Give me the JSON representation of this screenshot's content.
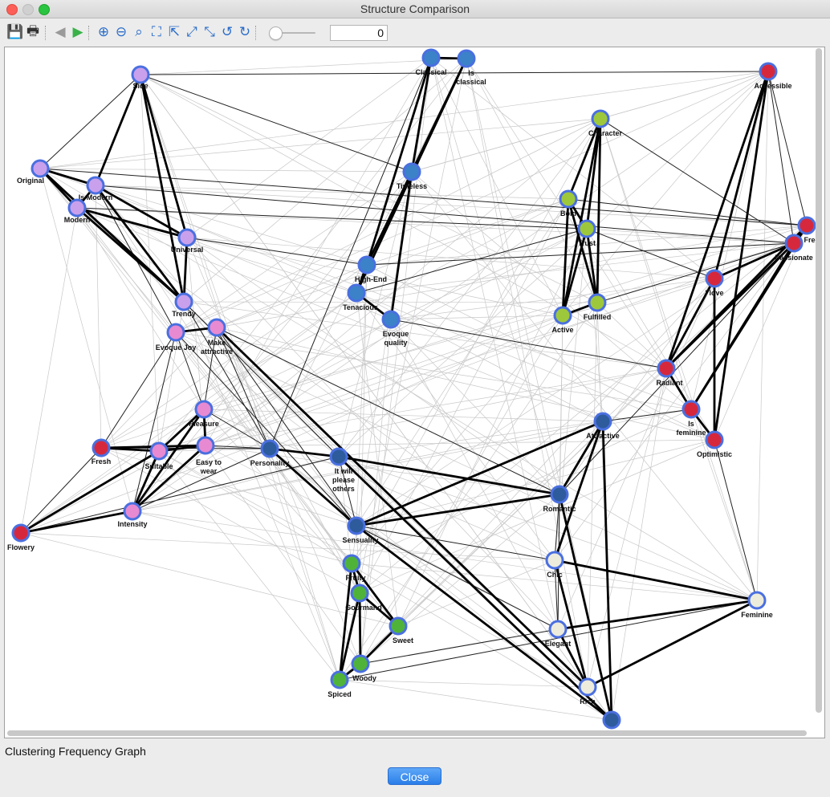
{
  "window": {
    "title": "Structure Comparison"
  },
  "toolbar": {
    "buttons": [
      {
        "name": "save-icon",
        "glyph": "💾"
      },
      {
        "name": "print-icon",
        "glyph": "🖶"
      },
      {
        "name": "back-icon",
        "glyph": "◀"
      },
      {
        "name": "forward-icon",
        "glyph": "▶"
      },
      {
        "name": "zoom-in-icon",
        "glyph": "⊕"
      },
      {
        "name": "zoom-out-icon",
        "glyph": "⊖"
      },
      {
        "name": "zoom-fit-icon",
        "glyph": "⌕"
      },
      {
        "name": "fit-all-icon",
        "glyph": "⛶"
      },
      {
        "name": "move-to-top-icon",
        "glyph": "⇱"
      },
      {
        "name": "expand-icon",
        "glyph": "⤢"
      },
      {
        "name": "collapse-icon",
        "glyph": "⤡"
      },
      {
        "name": "rotate-left-icon",
        "glyph": "↺"
      },
      {
        "name": "rotate-right-icon",
        "glyph": "↻"
      }
    ],
    "zoom_value": "0"
  },
  "graph": {
    "colors": {
      "purple": "#c9a0ec",
      "pink": "#e78ad1",
      "red": "#d6283d",
      "darkblue": "#2d5b9c",
      "blue": "#3b82c8",
      "lime": "#9ec83b",
      "green": "#4fb33a",
      "cream": "#ecebdc",
      "ring": "#4a6fe0"
    },
    "nodes": [
      {
        "id": "Side",
        "label": [
          "Side"
        ],
        "color": "purple"
      },
      {
        "id": "Original",
        "label": [
          "Original"
        ],
        "color": "purple"
      },
      {
        "id": "Is Modern",
        "label": [
          "Is Modern"
        ],
        "color": "purple"
      },
      {
        "id": "Modern",
        "label": [
          "Modern"
        ],
        "color": "purple"
      },
      {
        "id": "Universal",
        "label": [
          "Universal"
        ],
        "color": "purple"
      },
      {
        "id": "Trendy",
        "label": [
          "Trendy"
        ],
        "color": "purple"
      },
      {
        "id": "Evoque Joy",
        "label": [
          "Evoque Joy"
        ],
        "color": "pink"
      },
      {
        "id": "Make attractive",
        "label": [
          "Make",
          "attractive"
        ],
        "color": "pink"
      },
      {
        "id": "Pleasure",
        "label": [
          "Pleasure"
        ],
        "color": "pink"
      },
      {
        "id": "Easy to wear",
        "label": [
          "Easy to",
          "wear"
        ],
        "color": "pink"
      },
      {
        "id": "Suitable",
        "label": [
          "Suitable"
        ],
        "color": "pink"
      },
      {
        "id": "Intensity",
        "label": [
          "Intensity"
        ],
        "color": "pink"
      },
      {
        "id": "Fresh",
        "label": [
          "Fresh"
        ],
        "color": "red"
      },
      {
        "id": "Flowery",
        "label": [
          "Flowery"
        ],
        "color": "red"
      },
      {
        "id": "Classical",
        "label": [
          "Classical"
        ],
        "color": "blue"
      },
      {
        "id": "Is classical",
        "label": [
          "Is",
          "classical"
        ],
        "color": "blue"
      },
      {
        "id": "Timeless",
        "label": [
          "Timeless"
        ],
        "color": "blue"
      },
      {
        "id": "High-End",
        "label": [
          "High-End"
        ],
        "color": "blue"
      },
      {
        "id": "Tenacious",
        "label": [
          "Tenacious"
        ],
        "color": "blue"
      },
      {
        "id": "Evoque quality",
        "label": [
          "Evoque",
          "quality"
        ],
        "color": "blue"
      },
      {
        "id": "Personality",
        "label": [
          "Personality"
        ],
        "color": "darkblue"
      },
      {
        "id": "It will please others",
        "label": [
          "It will",
          "please",
          "others"
        ],
        "color": "darkblue"
      },
      {
        "id": "Sensuality",
        "label": [
          "Sensuality"
        ],
        "color": "darkblue"
      },
      {
        "id": "Attractive",
        "label": [
          "Attractive"
        ],
        "color": "darkblue"
      },
      {
        "id": "Romantic",
        "label": [
          "Romantic"
        ],
        "color": "darkblue"
      },
      {
        "id": "Bottom",
        "label": [],
        "color": "darkblue"
      },
      {
        "id": "Character",
        "label": [
          "Character"
        ],
        "color": "lime"
      },
      {
        "id": "Bold",
        "label": [
          "Bold"
        ],
        "color": "lime"
      },
      {
        "id": "Trust",
        "label": [
          "Trust"
        ],
        "color": "lime"
      },
      {
        "id": "Active",
        "label": [
          "Active"
        ],
        "color": "lime"
      },
      {
        "id": "Fulfilled",
        "label": [
          "Fulfilled"
        ],
        "color": "lime"
      },
      {
        "id": "Fruity",
        "label": [
          "Fruity"
        ],
        "color": "green"
      },
      {
        "id": "Gourmand",
        "label": [
          "Gourmand"
        ],
        "color": "green"
      },
      {
        "id": "Sweet",
        "label": [
          "Sweet"
        ],
        "color": "green"
      },
      {
        "id": "Woody",
        "label": [
          "Woody"
        ],
        "color": "green"
      },
      {
        "id": "Spiced",
        "label": [
          "Spiced"
        ],
        "color": "green"
      },
      {
        "id": "Accessible",
        "label": [
          "Accessible"
        ],
        "color": "red"
      },
      {
        "id": "Free",
        "label": [
          "Free"
        ],
        "color": "red"
      },
      {
        "id": "Passionate",
        "label": [
          "Passionate"
        ],
        "color": "red"
      },
      {
        "id": "I love",
        "label": [
          "I love"
        ],
        "color": "red"
      },
      {
        "id": "Radiant",
        "label": [
          "Radiant"
        ],
        "color": "red"
      },
      {
        "id": "Is feminine",
        "label": [
          "Is",
          "feminine"
        ],
        "color": "red"
      },
      {
        "id": "Optimistic",
        "label": [
          "Optimistic"
        ],
        "color": "red"
      },
      {
        "id": "Chic",
        "label": [
          "Chic"
        ],
        "color": "cream"
      },
      {
        "id": "Elegant",
        "label": [
          "Elegant"
        ],
        "color": "cream"
      },
      {
        "id": "Rich",
        "label": [
          "Rich"
        ],
        "color": "cream"
      },
      {
        "id": "Feminine",
        "label": [
          "Feminine"
        ],
        "color": "cream"
      }
    ],
    "strong_edges": [
      [
        "Side",
        "Is Modern"
      ],
      [
        "Side",
        "Universal"
      ],
      [
        "Side",
        "Trendy"
      ],
      [
        "Original",
        "Is Modern"
      ],
      [
        "Original",
        "Modern"
      ],
      [
        "Original",
        "Trendy"
      ],
      [
        "Is Modern",
        "Modern"
      ],
      [
        "Is Modern",
        "Universal"
      ],
      [
        "Is Modern",
        "Trendy"
      ],
      [
        "Modern",
        "Universal"
      ],
      [
        "Modern",
        "Trendy"
      ],
      [
        "Universal",
        "Trendy"
      ],
      [
        "Classical",
        "Is classical"
      ],
      [
        "Classical",
        "Timeless"
      ],
      [
        "Classical",
        "High-End"
      ],
      [
        "Is classical",
        "Timeless"
      ],
      [
        "Is classical",
        "Tenacious"
      ],
      [
        "Timeless",
        "Evoque quality"
      ],
      [
        "Timeless",
        "High-End"
      ],
      [
        "High-End",
        "Tenacious"
      ],
      [
        "Tenacious",
        "Evoque quality"
      ],
      [
        "Character",
        "Bold"
      ],
      [
        "Character",
        "Trust"
      ],
      [
        "Character",
        "Active"
      ],
      [
        "Character",
        "Fulfilled"
      ],
      [
        "Bold",
        "Trust"
      ],
      [
        "Bold",
        "Active"
      ],
      [
        "Bold",
        "Fulfilled"
      ],
      [
        "Trust",
        "Active"
      ],
      [
        "Trust",
        "Fulfilled"
      ],
      [
        "Active",
        "Fulfilled"
      ],
      [
        "Accessible",
        "Radiant"
      ],
      [
        "Accessible",
        "Optimistic"
      ],
      [
        "Accessible",
        "I love"
      ],
      [
        "Free",
        "Passionate"
      ],
      [
        "Free",
        "Radiant"
      ],
      [
        "Passionate",
        "I love"
      ],
      [
        "Passionate",
        "Radiant"
      ],
      [
        "Passionate",
        "Is feminine"
      ],
      [
        "I love",
        "Radiant"
      ],
      [
        "I love",
        "Optimistic"
      ],
      [
        "Radiant",
        "Is feminine"
      ],
      [
        "Is feminine",
        "Optimistic"
      ],
      [
        "Free",
        "Is feminine"
      ],
      [
        "Pleasure",
        "Easy to wear"
      ],
      [
        "Pleasure",
        "Suitable"
      ],
      [
        "Pleasure",
        "Intensity"
      ],
      [
        "Easy to wear",
        "Suitable"
      ],
      [
        "Easy to wear",
        "Intensity"
      ],
      [
        "Suitable",
        "Intensity"
      ],
      [
        "Fresh",
        "Suitable"
      ],
      [
        "Flowery",
        "Intensity"
      ],
      [
        "Flowery",
        "Suitable"
      ],
      [
        "Evoque Joy",
        "Make attractive"
      ],
      [
        "Fresh",
        "Easy to wear"
      ],
      [
        "Fruity",
        "Gourmand"
      ],
      [
        "Fruity",
        "Sweet"
      ],
      [
        "Fruity",
        "Spiced"
      ],
      [
        "Gourmand",
        "Woody"
      ],
      [
        "Gourmand",
        "Spiced"
      ],
      [
        "Sweet",
        "Woody"
      ],
      [
        "Woody",
        "Spiced"
      ],
      [
        "Sweet",
        "Gourmand"
      ],
      [
        "Personality",
        "It will please others"
      ],
      [
        "It will please others",
        "Romantic"
      ],
      [
        "Sensuality",
        "Romantic"
      ],
      [
        "Sensuality",
        "Attractive"
      ],
      [
        "Attractive",
        "Romantic"
      ],
      [
        "Attractive",
        "Chic"
      ],
      [
        "Romantic",
        "Bottom"
      ],
      [
        "Attractive",
        "Bottom"
      ],
      [
        "Chic",
        "Rich"
      ],
      [
        "Elegant",
        "Feminine"
      ],
      [
        "Rich",
        "Feminine"
      ],
      [
        "Elegant",
        "Rich"
      ],
      [
        "Chic",
        "Feminine"
      ],
      [
        "Sensuality",
        "Bottom"
      ],
      [
        "It will please others",
        "Bottom"
      ],
      [
        "Personality",
        "Sensuality"
      ],
      [
        "Make attractive",
        "Rich"
      ]
    ],
    "medium_edges": [
      [
        "Side",
        "Original"
      ],
      [
        "Side",
        "Accessible"
      ],
      [
        "Side",
        "Timeless"
      ],
      [
        "Original",
        "Free"
      ],
      [
        "Is Modern",
        "Passionate"
      ],
      [
        "Modern",
        "Trust"
      ],
      [
        "Universal",
        "High-End"
      ],
      [
        "Trendy",
        "Personality"
      ],
      [
        "Evoque Joy",
        "Fresh"
      ],
      [
        "Evoque Joy",
        "Intensity"
      ],
      [
        "Make attractive",
        "Personality"
      ],
      [
        "Make attractive",
        "Sensuality"
      ],
      [
        "Pleasure",
        "Personality"
      ],
      [
        "Easy to wear",
        "Personality"
      ],
      [
        "Personality",
        "Classical"
      ],
      [
        "It will please others",
        "Sensuality"
      ],
      [
        "Sensuality",
        "Chic"
      ],
      [
        "Sensuality",
        "Elegant"
      ],
      [
        "Romantic",
        "Chic"
      ],
      [
        "Romantic",
        "Elegant"
      ],
      [
        "Chic",
        "Elegant"
      ],
      [
        "Elegant",
        "Woody"
      ],
      [
        "Spiced",
        "Feminine"
      ],
      [
        "Attractive",
        "Is feminine"
      ],
      [
        "Romantic",
        "Passionate"
      ],
      [
        "Character",
        "Passionate"
      ],
      [
        "Bold",
        "Free"
      ],
      [
        "Trust",
        "I love"
      ],
      [
        "Fulfilled",
        "Passionate"
      ],
      [
        "Evoque quality",
        "Radiant"
      ],
      [
        "Tenacious",
        "Trust"
      ],
      [
        "Fresh",
        "Flowery"
      ],
      [
        "Fresh",
        "Personality"
      ],
      [
        "Intensity",
        "Personality"
      ],
      [
        "Flowery",
        "It will please others"
      ],
      [
        "Trendy",
        "It will please others"
      ],
      [
        "Make attractive",
        "Romantic"
      ],
      [
        "Evoque Joy",
        "Sensuality"
      ],
      [
        "Feminine",
        "Optimistic"
      ],
      [
        "High-End",
        "Passionate"
      ],
      [
        "Accessible",
        "Free"
      ],
      [
        "Accessible",
        "Passionate"
      ],
      [
        "Is Modern",
        "Evoque Joy"
      ],
      [
        "Evoque Joy",
        "Pleasure"
      ],
      [
        "Make attractive",
        "Pleasure"
      ]
    ]
  },
  "status_label": "Clustering Frequency Graph",
  "close_label": "Close"
}
